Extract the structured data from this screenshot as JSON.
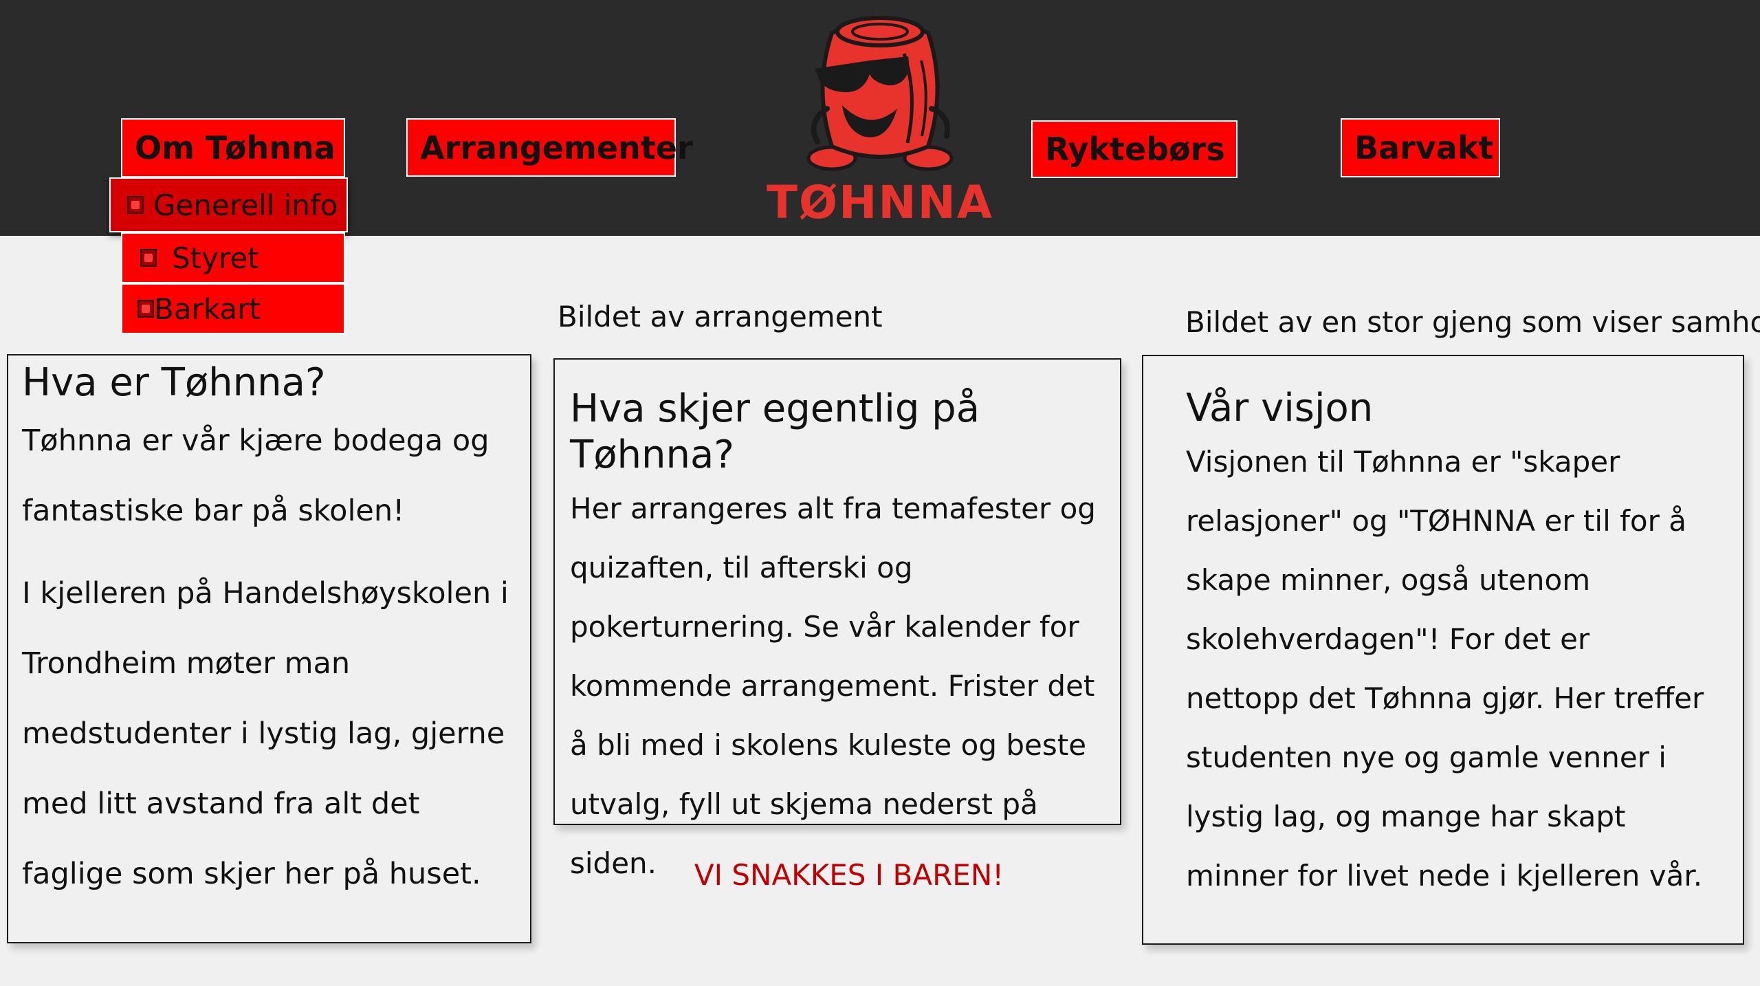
{
  "header": {
    "nav": {
      "om": "Om Tøhnna",
      "arrangementer": "Arrangementer",
      "ryktebors": "Ryktebørs",
      "barvakt": "Barvakt"
    },
    "submenu": {
      "generell": "Generell info",
      "styret": "Styret",
      "barkart": "Barkart"
    },
    "logo_text": "TØHNNA"
  },
  "captions": {
    "arrangement_image": "Bildet av arrangement",
    "group_image": "Bildet av en stor gjeng som viser samhold"
  },
  "cards": {
    "left": {
      "title": "Hva er Tøhnna?",
      "p1": "Tøhnna er vår kjære bodega og fantastiske bar på skolen!",
      "p2": "I kjelleren på Handelshøyskolen i Trondheim møter man medstudenter i lystig lag, gjerne med litt avstand fra alt det faglige som skjer her på huset."
    },
    "middle": {
      "title": "Hva skjer egentlig på Tøhnna?",
      "body": "Her arrangeres alt fra temafester og quizaften, til afterski og pokerturnering. Se vår kalender for kommende arrangement. Frister det å bli med i skolens kuleste og beste utvalg, fyll ut skjema nederst på siden."
    },
    "right": {
      "title": "Vår visjon",
      "body": "Visjonen til Tøhnna er \"skaper relasjoner\" og \"TØHNNA er til for å skape minner, også utenom skolehverdagen\"! For det er nettopp det Tøhnna gjør. Her treffer studenten nye og gamle venner i lystig lag, og mange har skapt minner for livet nede i kjelleren vår."
    }
  },
  "footer_message": "VI SNAKKES I BAREN!",
  "colors": {
    "header_bg": "#2b2b2b",
    "nav_red": "#ff0000",
    "logo_red": "#e8332c",
    "footer_red": "#c00000"
  }
}
